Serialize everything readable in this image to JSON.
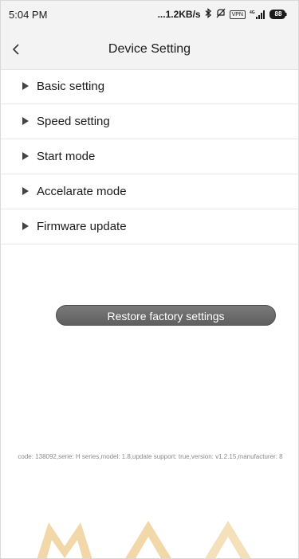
{
  "status_bar": {
    "time": "5:04 PM",
    "network_speed": "...1.2KB/s",
    "vpn_label": "VPN",
    "network_type": "4G",
    "battery_level": "88",
    "icons": [
      "bluetooth-icon",
      "mute-icon",
      "vpn-icon",
      "signal-icon",
      "battery-icon"
    ]
  },
  "header": {
    "back_label": "<",
    "title": "Device Setting"
  },
  "menu": {
    "items": [
      {
        "label": "Basic setting"
      },
      {
        "label": "Speed setting"
      },
      {
        "label": "Start mode"
      },
      {
        "label": "Accelarate mode"
      },
      {
        "label": "Firmware update"
      }
    ]
  },
  "restore_button": {
    "label": "Restore factory settings"
  },
  "device_info": {
    "text": "code: 138092,serie: H series,model: 1.8,update support: true,version: v1.2.15,manufacturer: 8"
  },
  "colors": {
    "header_bg": "#f3f3f3",
    "button_bg": "#6b6b6b",
    "watermark": "#f2d7a8",
    "info_text": "#8a8a8a"
  }
}
